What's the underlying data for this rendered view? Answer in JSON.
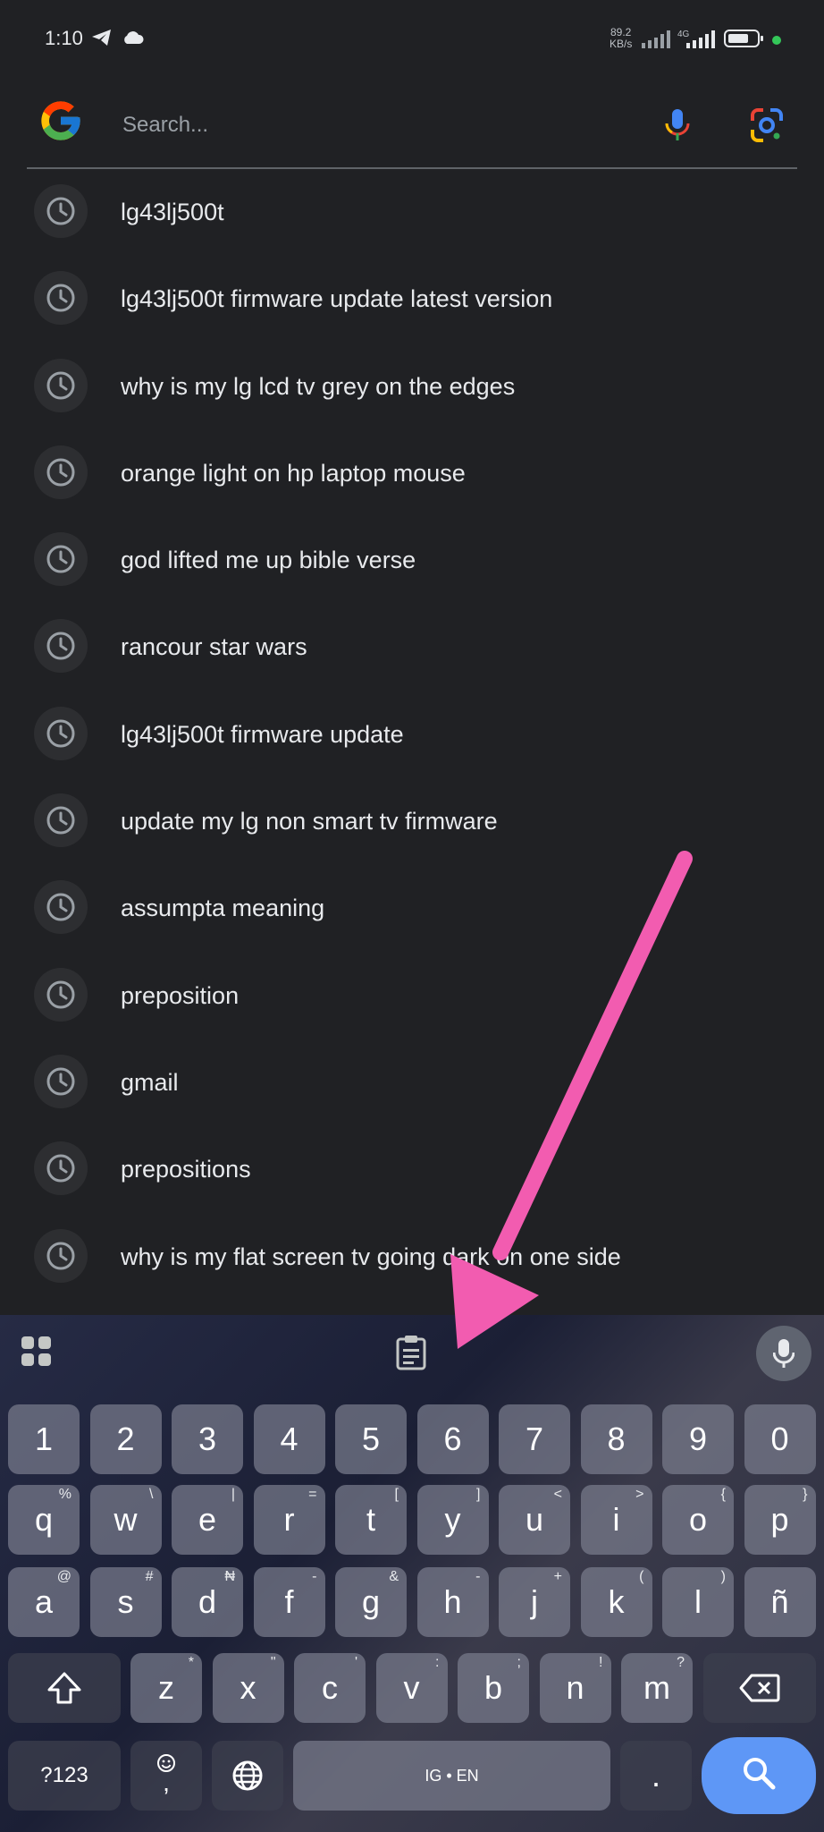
{
  "status": {
    "time": "1:10",
    "speed_value": "89.2",
    "speed_unit": "KB/s",
    "network": "4G"
  },
  "search": {
    "placeholder": "Search...",
    "value": ""
  },
  "history": [
    "lg43lj500t",
    "lg43lj500t firmware update latest version",
    "why is my lg lcd tv grey on the edges",
    "orange light on hp laptop mouse",
    "god lifted me up bible verse",
    "rancour star wars",
    "lg43lj500t firmware update",
    "update my lg non smart tv firmware",
    "assumpta meaning",
    "preposition",
    "gmail",
    "prepositions",
    "why is my flat screen tv going dark on one side"
  ],
  "keyboard": {
    "numbers": [
      "1",
      "2",
      "3",
      "4",
      "5",
      "6",
      "7",
      "8",
      "9",
      "0"
    ],
    "row1": [
      "q",
      "w",
      "e",
      "r",
      "t",
      "y",
      "u",
      "i",
      "o",
      "p"
    ],
    "row1_sup": [
      "%",
      "\\",
      "|",
      "=",
      "[",
      "]",
      "<",
      ">",
      "{",
      "}"
    ],
    "row2": [
      "a",
      "s",
      "d",
      "f",
      "g",
      "h",
      "j",
      "k",
      "l",
      "ñ"
    ],
    "row2_sup": [
      "@",
      "#",
      "₦",
      "-",
      "&",
      "-",
      "+",
      "(",
      ")",
      ""
    ],
    "row3": [
      "z",
      "x",
      "c",
      "v",
      "b",
      "n",
      "m"
    ],
    "row3_sup": [
      "*",
      "\"",
      "'",
      ":",
      ";",
      "!",
      "?"
    ],
    "symbols_label": "?123",
    "comma": ",",
    "space_label": "IG • EN",
    "period": "."
  },
  "colors": {
    "background": "#202124",
    "accent_arrow": "#f25cb0",
    "search_key": "#5e97f6"
  }
}
